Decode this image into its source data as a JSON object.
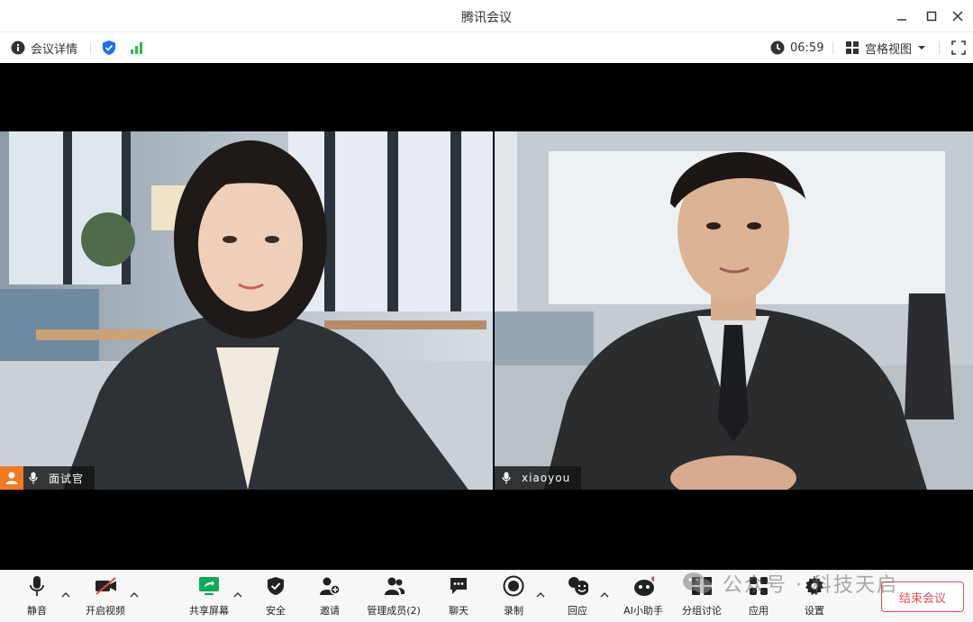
{
  "window": {
    "title": "腾讯会议"
  },
  "infobar": {
    "meeting_info_label": "会议详情",
    "timer": "06:59",
    "view_mode_label": "宫格视图"
  },
  "participants": [
    {
      "name": "面试官",
      "is_host": true
    },
    {
      "name": "xiaoyou",
      "is_host": false
    }
  ],
  "toolbar": {
    "mute_label": "静音",
    "video_label": "开启视频",
    "share_label": "共享屏幕",
    "security_label": "安全",
    "invite_label": "邀请",
    "members_label": "管理成员(2)",
    "chat_label": "聊天",
    "record_label": "录制",
    "reaction_label": "回应",
    "ai_label": "AI小助手",
    "breakout_label": "分组讨论",
    "apps_label": "应用",
    "settings_label": "设置",
    "end_label": "结束会议"
  },
  "watermark": {
    "text": "公众号 · 科技天启"
  },
  "colors": {
    "accent_blue": "#1e6ef4",
    "signal_green": "#2db84d",
    "host_orange": "#f07b22",
    "end_red": "#e84b4b",
    "share_green": "#0fa958"
  }
}
